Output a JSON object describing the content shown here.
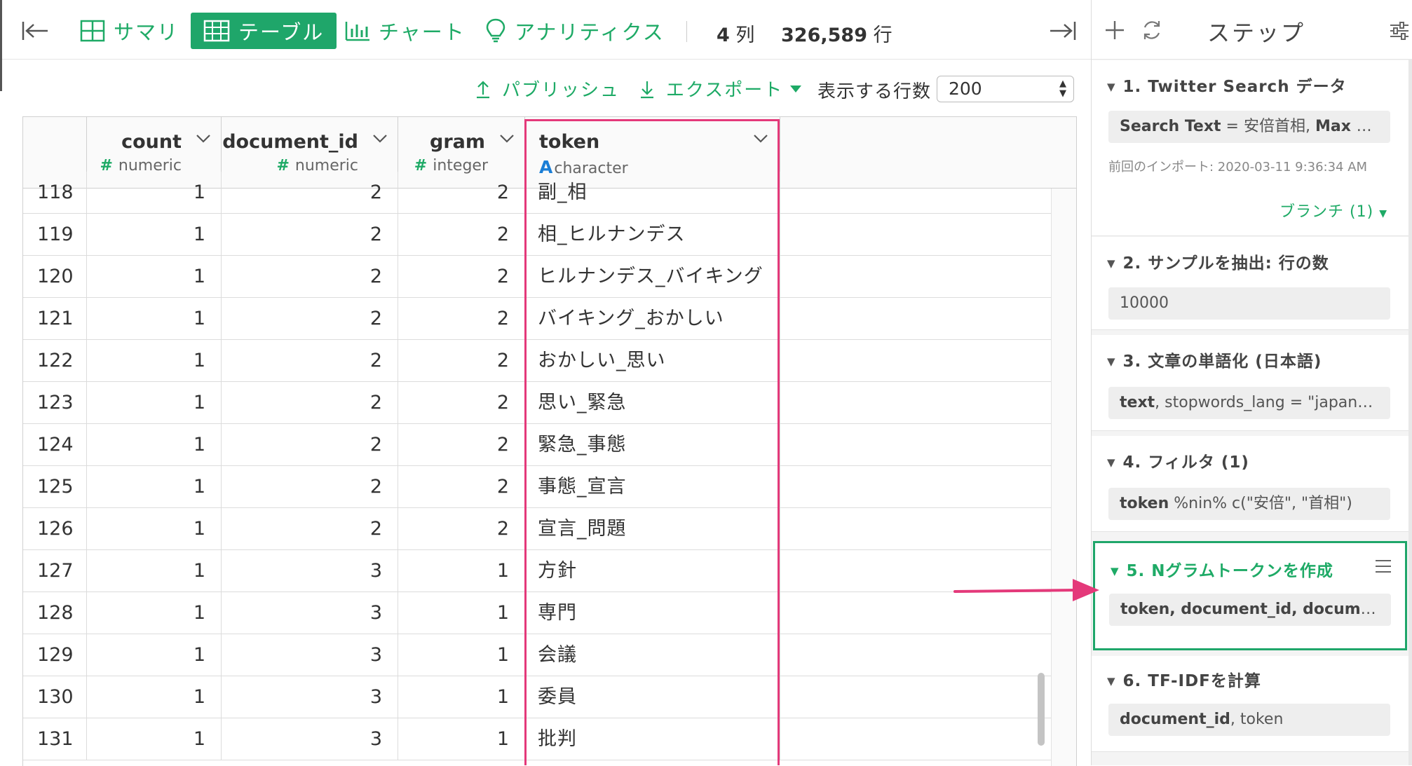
{
  "toolbar": {
    "tabs": [
      {
        "label": "サマリ",
        "icon": "grid-icon"
      },
      {
        "label": "テーブル",
        "icon": "table-icon",
        "active": true
      },
      {
        "label": "チャート",
        "icon": "bar-chart-icon"
      },
      {
        "label": "アナリティクス",
        "icon": "lightbulb-icon"
      }
    ],
    "col_count": "4",
    "col_unit": "列",
    "row_count": "326,589",
    "row_unit": "行"
  },
  "actions": {
    "publish": "パブリッシュ",
    "export": "エクスポート",
    "rows_label": "表示する行数",
    "rows_value": "200"
  },
  "table": {
    "columns": [
      {
        "name": "count",
        "type": "numeric",
        "type_icon": "#"
      },
      {
        "name": "document_id",
        "type": "numeric",
        "type_icon": "#"
      },
      {
        "name": "gram",
        "type": "integer",
        "type_icon": "#"
      },
      {
        "name": "token",
        "type": "character",
        "type_icon": "A"
      }
    ],
    "rows": [
      [
        "118",
        "1",
        "2",
        "2",
        "副_相"
      ],
      [
        "119",
        "1",
        "2",
        "2",
        "相_ヒルナンデス"
      ],
      [
        "120",
        "1",
        "2",
        "2",
        "ヒルナンデス_バイキング"
      ],
      [
        "121",
        "1",
        "2",
        "2",
        "バイキング_おかしい"
      ],
      [
        "122",
        "1",
        "2",
        "2",
        "おかしい_思い"
      ],
      [
        "123",
        "1",
        "2",
        "2",
        "思い_緊急"
      ],
      [
        "124",
        "1",
        "2",
        "2",
        "緊急_事態"
      ],
      [
        "125",
        "1",
        "2",
        "2",
        "事態_宣言"
      ],
      [
        "126",
        "1",
        "2",
        "2",
        "宣言_問題"
      ],
      [
        "127",
        "1",
        "3",
        "1",
        "方針"
      ],
      [
        "128",
        "1",
        "3",
        "1",
        "専門"
      ],
      [
        "129",
        "1",
        "3",
        "1",
        "会議"
      ],
      [
        "130",
        "1",
        "3",
        "1",
        "委員"
      ],
      [
        "131",
        "1",
        "3",
        "1",
        "批判"
      ]
    ]
  },
  "steps_panel": {
    "title": "ステップ",
    "steps": [
      {
        "title": "1. Twitter Search データ",
        "body_bold1": "Search Text",
        "body_mid": " = 安倍首相, ",
        "body_bold2": "Max #",
        "body_tail": " ...",
        "meta": "前回のインポート: 2020-03-11 9:36:34 AM",
        "branch": "ブランチ (1)"
      },
      {
        "title": "2. サンプルを抽出: 行の数",
        "body": "10000"
      },
      {
        "title": "3. 文章の単語化 (日本語)",
        "body_bold": "text",
        "body_rest": ", stopwords_lang = \"japanese\""
      },
      {
        "title": "4. フィルタ (1)",
        "body_bold": "token",
        "body_rest": " %nin% c(\"安倍\", \"首相\")"
      },
      {
        "title": "5. Nグラムトークンを作成",
        "body": "token, document_id, documen..."
      },
      {
        "title": "6. TF-IDFを計算",
        "body_bold": "document_id",
        "body_rest": ", token"
      }
    ]
  }
}
